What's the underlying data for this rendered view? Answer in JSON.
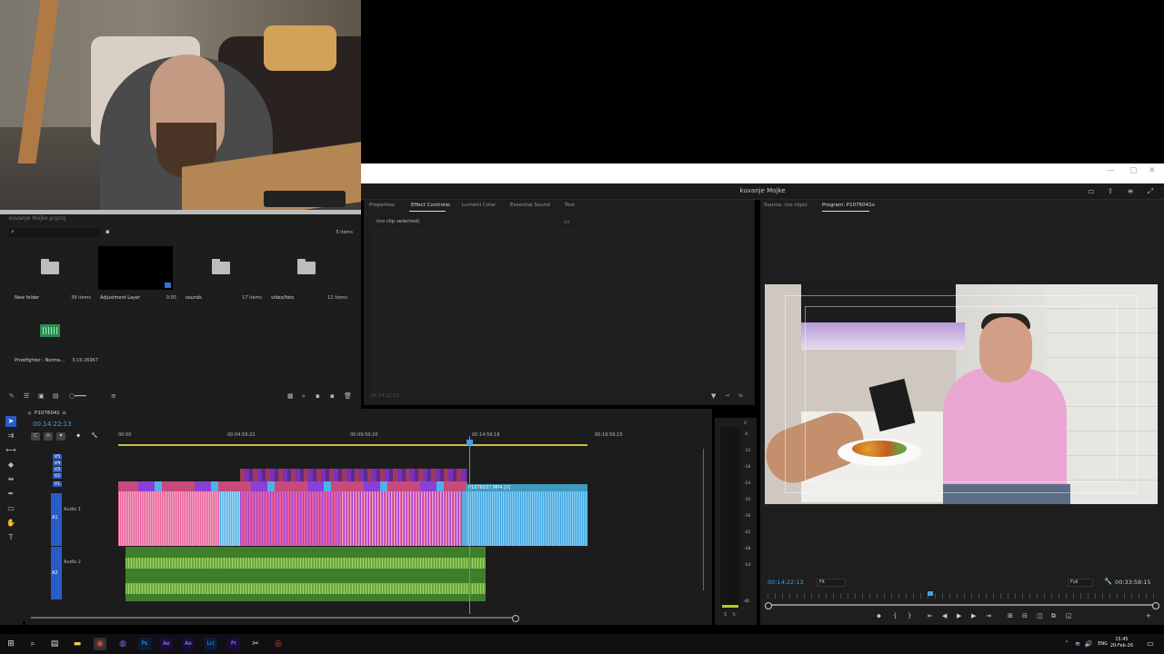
{
  "window": {
    "title": "kuvanje Mojke"
  },
  "project": {
    "name": "kuvanje Mojke.prproj",
    "items_count": "5 items",
    "bins": [
      {
        "name": "New folder",
        "meta": "39 items",
        "kind": "folder"
      },
      {
        "name": "Adjustment Layer",
        "meta": "0:05",
        "kind": "adjustment"
      },
      {
        "name": "sounds",
        "meta": "17 items",
        "kind": "folder"
      },
      {
        "name": "video/foto",
        "meta": "12 items",
        "kind": "folder"
      },
      {
        "name": "Prizefighter - Norma...",
        "meta": "3:16:26967",
        "kind": "audio"
      }
    ]
  },
  "effect_controls": {
    "tabs": [
      "Properties",
      "Effect Controls",
      "Lumetri Color",
      "Essential Sound",
      "Text"
    ],
    "active_tab": "Effect Controls",
    "no_clip": "(no clip selected)",
    "timecode": "00:14:22:13"
  },
  "program": {
    "tabs": [
      "Source: (no clips)",
      "Program: P1076041"
    ],
    "active_tab": "Program: P1076041",
    "timecode": "00:14:22:13",
    "fit": "Fit",
    "resolution": "Full",
    "duration": "00:33:58:15",
    "playhead_fraction": 0.42
  },
  "timeline": {
    "sequence_name": "P1076041",
    "timecode": "00:14:22:13",
    "ruler_labels": [
      "00:00",
      "00:04:59:22",
      "00:09:59:20",
      "00:14:59:18",
      "00:19:59:15"
    ],
    "video_tracks": [
      "V5",
      "V4",
      "V3",
      "V2",
      "V1"
    ],
    "audio_tracks": [
      {
        "id": "A1",
        "name": "Audio 1"
      },
      {
        "id": "A2",
        "name": "Audio 2"
      }
    ],
    "clip_label": "P1076037.MP4 [V]",
    "tool_icons": [
      "selection-tool",
      "track-select-tool",
      "ripple-edit-tool",
      "razor-tool",
      "slip-tool",
      "pen-tool",
      "rectangle-tool",
      "hand-tool",
      "type-tool"
    ]
  },
  "meter": {
    "db_labels": [
      "0",
      "-6",
      "-12",
      "-18",
      "-24",
      "-30",
      "-36",
      "-42",
      "-48",
      "-54",
      "dB"
    ],
    "solo": "S",
    "solo2": "S"
  },
  "taskbar": {
    "lang": "ENG",
    "time": "15:45",
    "date": "20-Feb-26",
    "apps": [
      "start",
      "search",
      "task-view",
      "explorer",
      "chrome",
      "app-purple",
      "photoshop",
      "after-effects",
      "after-effects-2",
      "lightroom",
      "premiere",
      "snipping",
      "app-red"
    ]
  },
  "colors": {
    "accent": "#3fa1e6",
    "selected_tool": "#2a5cc8",
    "audio1_pink": "#e0578f",
    "audio1_purple": "#8a3fd6",
    "audio1_blue": "#4fb1e6",
    "audio2_green": "#5a9a35",
    "workarea": "#c9c03a"
  }
}
